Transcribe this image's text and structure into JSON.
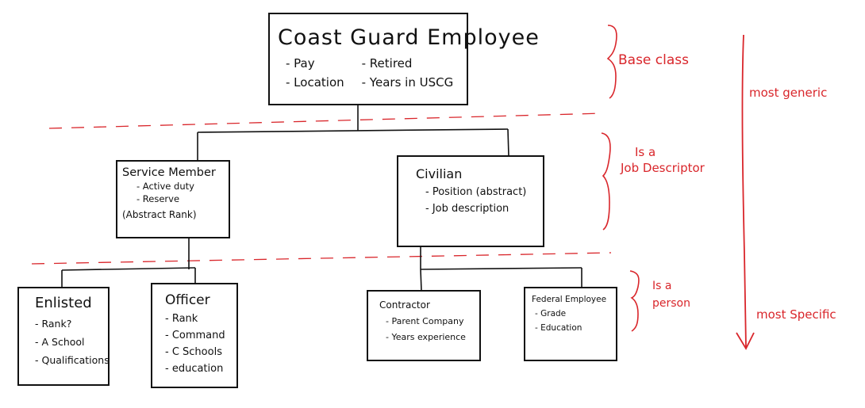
{
  "root": {
    "title": "Coast Guard Employee",
    "left_items": [
      "Pay",
      "Location"
    ],
    "right_items": [
      "Retired",
      "Years in USCG"
    ]
  },
  "service_member": {
    "title": "Service Member",
    "items": [
      "Active duty",
      "Reserve"
    ],
    "note": "(Abstract Rank)"
  },
  "civilian": {
    "title": "Civilian",
    "items": [
      "Position (abstract)",
      "Job description"
    ]
  },
  "enlisted": {
    "title": "Enlisted",
    "items": [
      "Rank?",
      "A School",
      "Qualifications"
    ]
  },
  "officer": {
    "title": "Officer",
    "items": [
      "Rank",
      "Command",
      "C Schools",
      "education"
    ]
  },
  "contractor": {
    "title": "Contractor",
    "items": [
      "Parent Company",
      "Years experience"
    ]
  },
  "federal_employee": {
    "title": "Federal Employee",
    "items": [
      "Grade",
      "Education"
    ]
  },
  "annotations": {
    "base_class": "Base class",
    "job_descriptor_1": "Is a",
    "job_descriptor_2": "Job Descriptor",
    "person_1": "Is a",
    "person_2": "person",
    "most_generic": "most generic",
    "most_specific": "most Specific"
  },
  "colors": {
    "ink": "#111111",
    "annotation": "#d9262b"
  }
}
